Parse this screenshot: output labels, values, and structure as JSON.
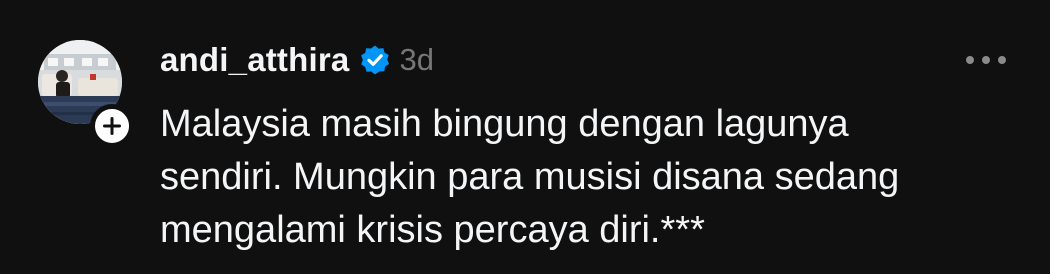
{
  "post": {
    "author": {
      "username": "andi_atthira",
      "verified": true,
      "avatar": "profile-photo"
    },
    "timestamp": "3d",
    "text": "Malaysia masih bingung dengan lagunya\nsendiri. Mungkin para musisi disana sedang\nmengalami krisis percaya diri.***",
    "icons": {
      "verified": "verified-badge-icon",
      "follow": "plus-icon",
      "more": "more-horizontal-icon"
    }
  },
  "colors": {
    "background": "#101010",
    "text_primary": "#f3f5f7",
    "text_secondary": "#777777",
    "verified_blue": "#0095f6"
  }
}
